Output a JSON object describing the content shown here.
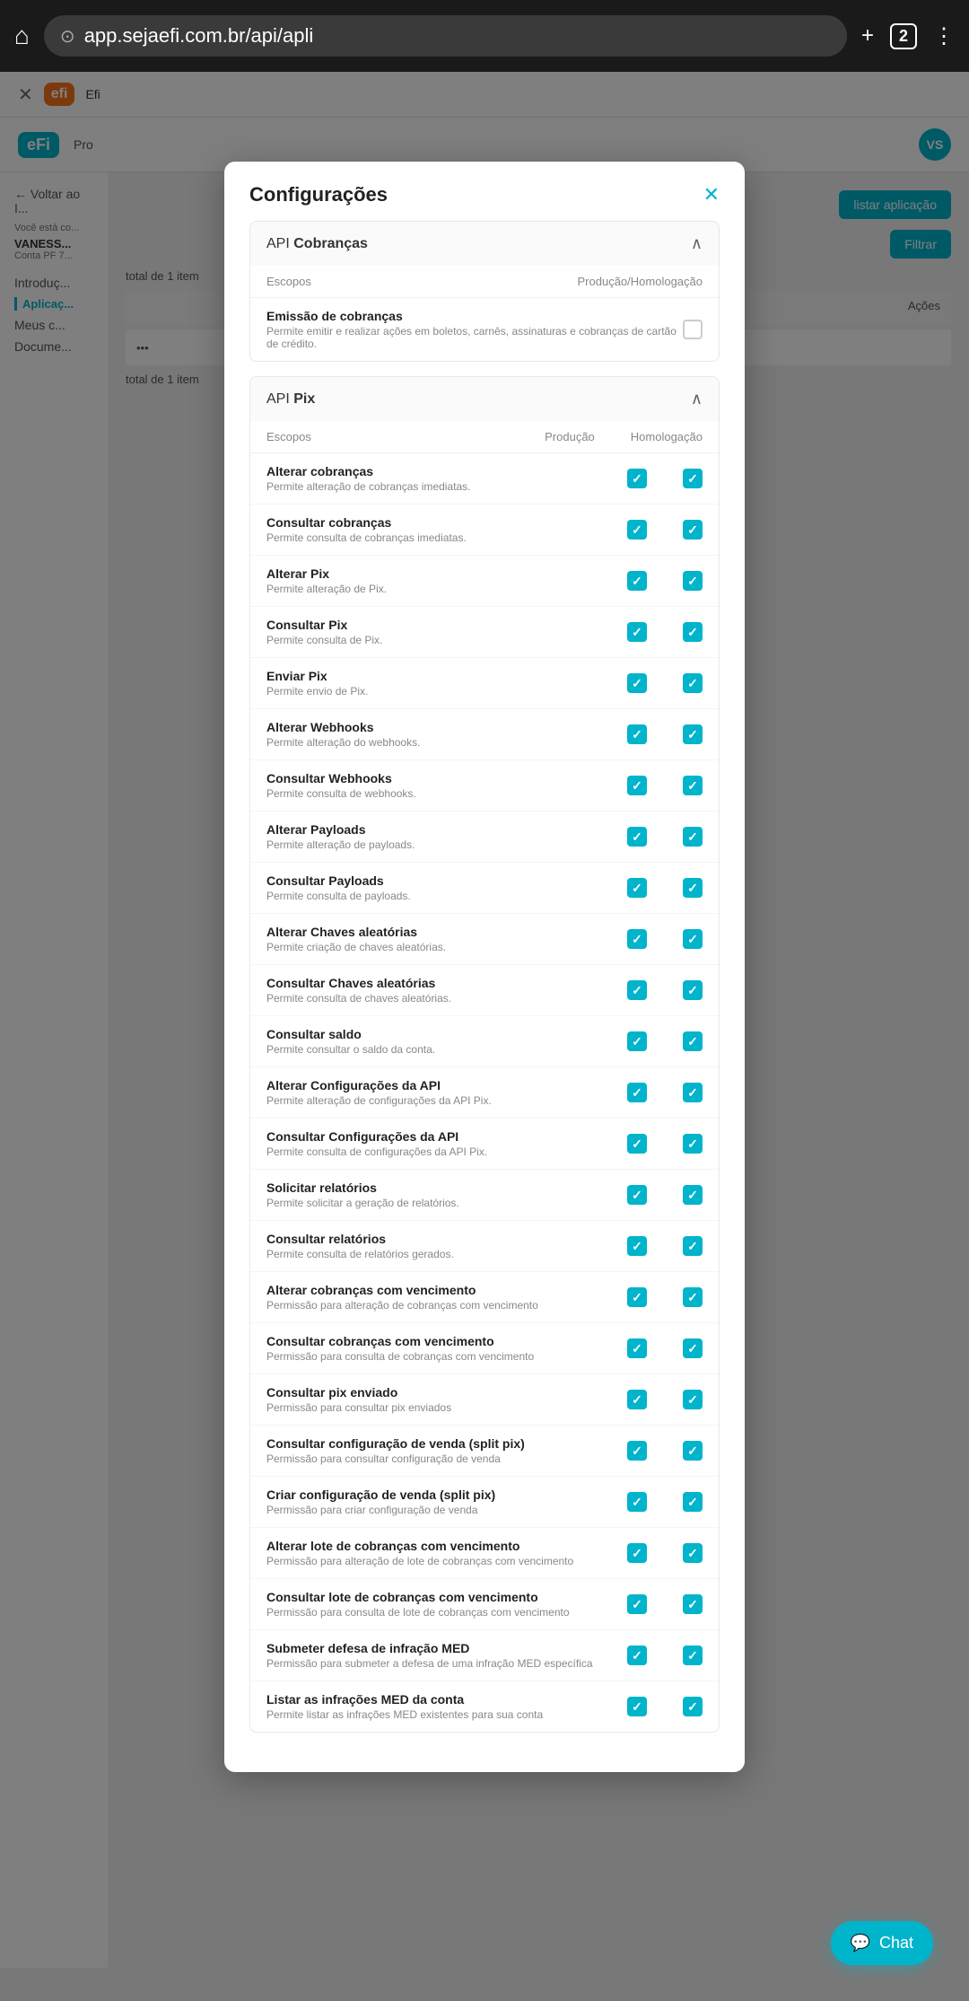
{
  "browser": {
    "url": "app.sejaefi.com.br/api/apli",
    "tab_count": "2",
    "home_icon": "⌂",
    "add_icon": "+",
    "menu_icon": "⋮"
  },
  "modal": {
    "title": "Configurações",
    "close_label": "✕",
    "api_cobrancas": {
      "label_prefix": "API ",
      "label_bold": "Cobranças",
      "chevron": "∧",
      "scopes_col": "Escopos",
      "prod_hom_col": "Produção/Homologação",
      "rows": [
        {
          "name": "Emissão de cobranças",
          "desc": "Permite emitir e realizar ações em boletos, carnês, assinaturas e cobranças de cartão de crédito.",
          "checked": false
        }
      ]
    },
    "api_pix": {
      "label_prefix": "API ",
      "label_bold": "Pix",
      "chevron": "∧",
      "scopes_col": "Escopos",
      "prod_col": "Produção",
      "hom_col": "Homologação",
      "rows": [
        {
          "name": "Alterar cobranças",
          "desc": "Permite alteração de cobranças imediatas.",
          "prod": true,
          "hom": true
        },
        {
          "name": "Consultar cobranças",
          "desc": "Permite consulta de cobranças imediatas.",
          "prod": true,
          "hom": true
        },
        {
          "name": "Alterar Pix",
          "desc": "Permite alteração de Pix.",
          "prod": true,
          "hom": true
        },
        {
          "name": "Consultar Pix",
          "desc": "Permite consulta de Pix.",
          "prod": true,
          "hom": true
        },
        {
          "name": "Enviar Pix",
          "desc": "Permite envio de Pix.",
          "prod": true,
          "hom": true
        },
        {
          "name": "Alterar Webhooks",
          "desc": "Permite alteração do webhooks.",
          "prod": true,
          "hom": true
        },
        {
          "name": "Consultar Webhooks",
          "desc": "Permite consulta de webhooks.",
          "prod": true,
          "hom": true
        },
        {
          "name": "Alterar Payloads",
          "desc": "Permite alteração de payloads.",
          "prod": true,
          "hom": true
        },
        {
          "name": "Consultar Payloads",
          "desc": "Permite consulta de payloads.",
          "prod": true,
          "hom": true
        },
        {
          "name": "Alterar Chaves aleatórias",
          "desc": "Permite criação de chaves aleatórias.",
          "prod": true,
          "hom": true
        },
        {
          "name": "Consultar Chaves aleatórias",
          "desc": "Permite consulta de chaves aleatórias.",
          "prod": true,
          "hom": true
        },
        {
          "name": "Consultar saldo",
          "desc": "Permite consultar o saldo da conta.",
          "prod": true,
          "hom": true
        },
        {
          "name": "Alterar Configurações da API",
          "desc": "Permite alteração de configurações da API Pix.",
          "prod": true,
          "hom": true
        },
        {
          "name": "Consultar Configurações da API",
          "desc": "Permite consulta de configurações da API Pix.",
          "prod": true,
          "hom": true
        },
        {
          "name": "Solicitar relatórios",
          "desc": "Permite solicitar a geração de relatórios.",
          "prod": true,
          "hom": true
        },
        {
          "name": "Consultar relatórios",
          "desc": "Permite consulta de relatórios gerados.",
          "prod": true,
          "hom": true
        },
        {
          "name": "Alterar cobranças com vencimento",
          "desc": "Permissão para alteração de cobranças com vencimento",
          "prod": true,
          "hom": true
        },
        {
          "name": "Consultar cobranças com vencimento",
          "desc": "Permissão para consulta de cobranças com vencimento",
          "prod": true,
          "hom": true
        },
        {
          "name": "Consultar pix enviado",
          "desc": "Permissão para consultar pix enviados",
          "prod": true,
          "hom": true
        },
        {
          "name": "Consultar configuração de venda (split pix)",
          "desc": "Permissão para consultar configuração de venda",
          "prod": true,
          "hom": true
        },
        {
          "name": "Criar configuração de venda (split pix)",
          "desc": "Permissão para criar configuração de venda",
          "prod": true,
          "hom": true
        },
        {
          "name": "Alterar lote de cobranças com vencimento",
          "desc": "Permissão para alteração de lote de cobranças com vencimento",
          "prod": true,
          "hom": true
        },
        {
          "name": "Consultar lote de cobranças com vencimento",
          "desc": "Permissão para consulta de lote de cobranças com vencimento",
          "prod": true,
          "hom": true
        },
        {
          "name": "Submeter defesa de infração MED",
          "desc": "Permissão para submeter a defesa de uma infração MED específica",
          "prod": true,
          "hom": true
        },
        {
          "name": "Listar as infrações MED da conta",
          "desc": "Permite listar as infrações MED existentes para sua conta",
          "prod": true,
          "hom": true
        }
      ]
    }
  },
  "chat": {
    "label": "Chat",
    "icon": "💬"
  }
}
